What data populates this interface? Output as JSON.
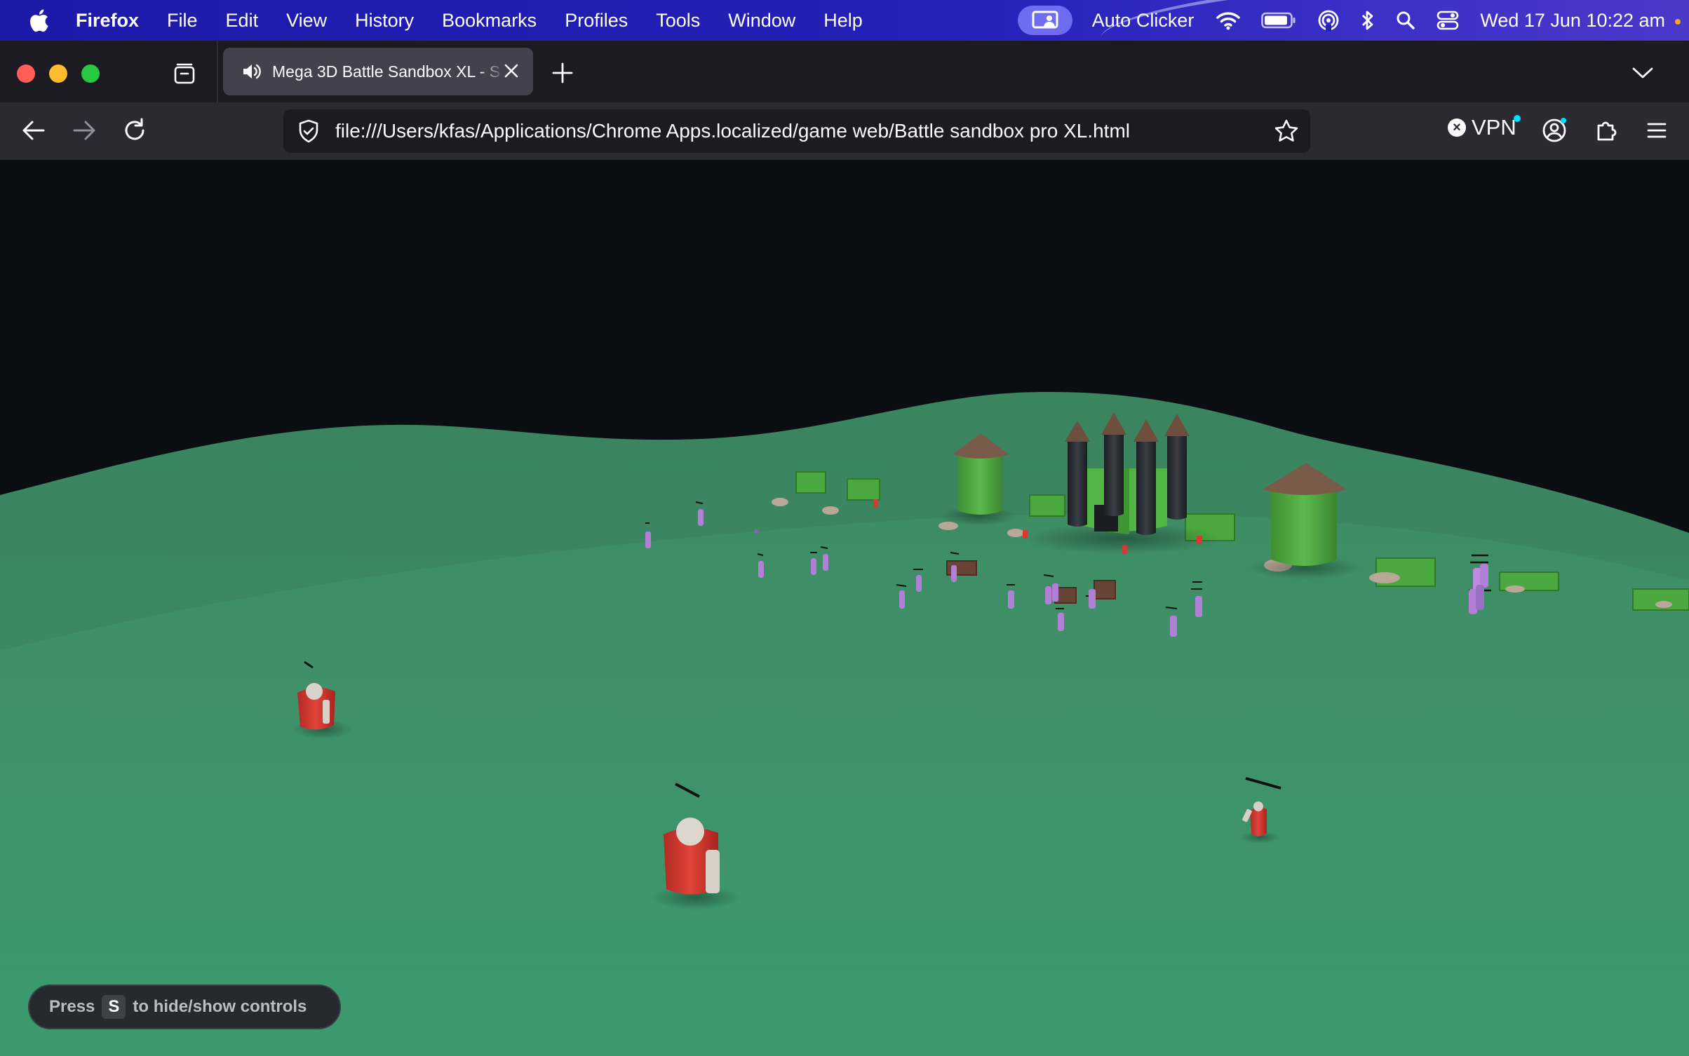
{
  "menubar": {
    "app_name": "Firefox",
    "items": [
      "File",
      "Edit",
      "View",
      "History",
      "Bookmarks",
      "Profiles",
      "Tools",
      "Window",
      "Help"
    ],
    "status": {
      "auto_clicker": "Auto Clicker",
      "datetime": "Wed 17 Jun  10:22 am"
    }
  },
  "browser": {
    "tab": {
      "title": "Mega 3D Battle Sandbox XL - S"
    },
    "url": "file:///Users/kfas/Applications/Chrome Apps.localized/game web/Battle sandbox pro XL.html",
    "vpn_label": "VPN"
  },
  "game": {
    "hint": {
      "prefix": "Press",
      "key": "S",
      "suffix": "to hide/show controls"
    },
    "colors": {
      "ground": "#3f8e68",
      "sky": "#0a0d11",
      "red_team": "#d63a32",
      "purple_team": "#b27fd6",
      "castle_green": "#4aa83e"
    }
  }
}
